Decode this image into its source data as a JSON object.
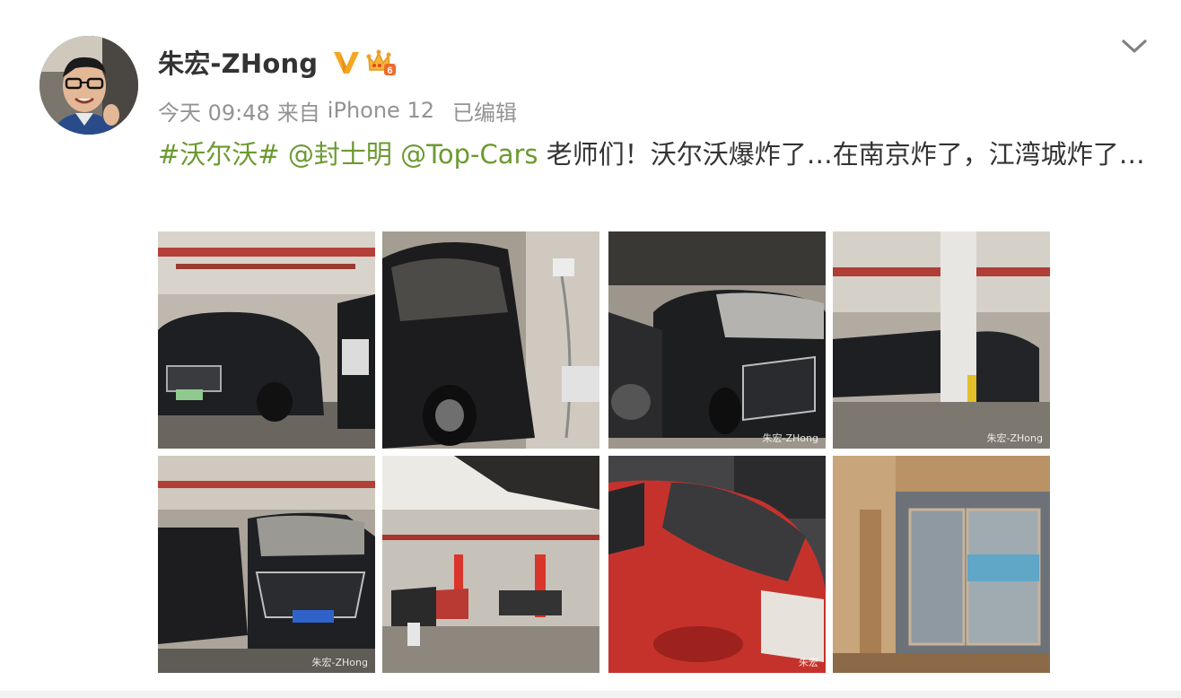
{
  "author": {
    "name": "朱宏-ZHong",
    "verified_icon": "verified-v-icon",
    "vip_icon": "vip-crown-icon",
    "vip_level": "6"
  },
  "meta": {
    "time": "今天 09:48",
    "from_label": "来自",
    "device": "iPhone 12",
    "edited": "已编辑"
  },
  "post": {
    "hashtag": "#沃尔沃#",
    "mention_1": "@封士明",
    "mention_2": "@Top-Cars",
    "body": " 老师们！沃尔沃爆炸了…在南京炸了，江湾城炸了…"
  },
  "more_icon": "chevron-down-icon",
  "photos": [
    {
      "name": "photo-1",
      "watermark": ""
    },
    {
      "name": "photo-2",
      "watermark": ""
    },
    {
      "name": "photo-3",
      "watermark": "朱宏-ZHong"
    },
    {
      "name": "photo-4",
      "watermark": "朱宏-ZHong"
    },
    {
      "name": "photo-5",
      "watermark": "朱宏-ZHong"
    },
    {
      "name": "photo-6",
      "watermark": ""
    },
    {
      "name": "photo-7",
      "watermark": "朱宏"
    },
    {
      "name": "photo-8",
      "watermark": ""
    }
  ],
  "colors": {
    "link": "#6b9a30",
    "meta": "#939393",
    "text": "#333333",
    "verified": "#f5a623"
  }
}
